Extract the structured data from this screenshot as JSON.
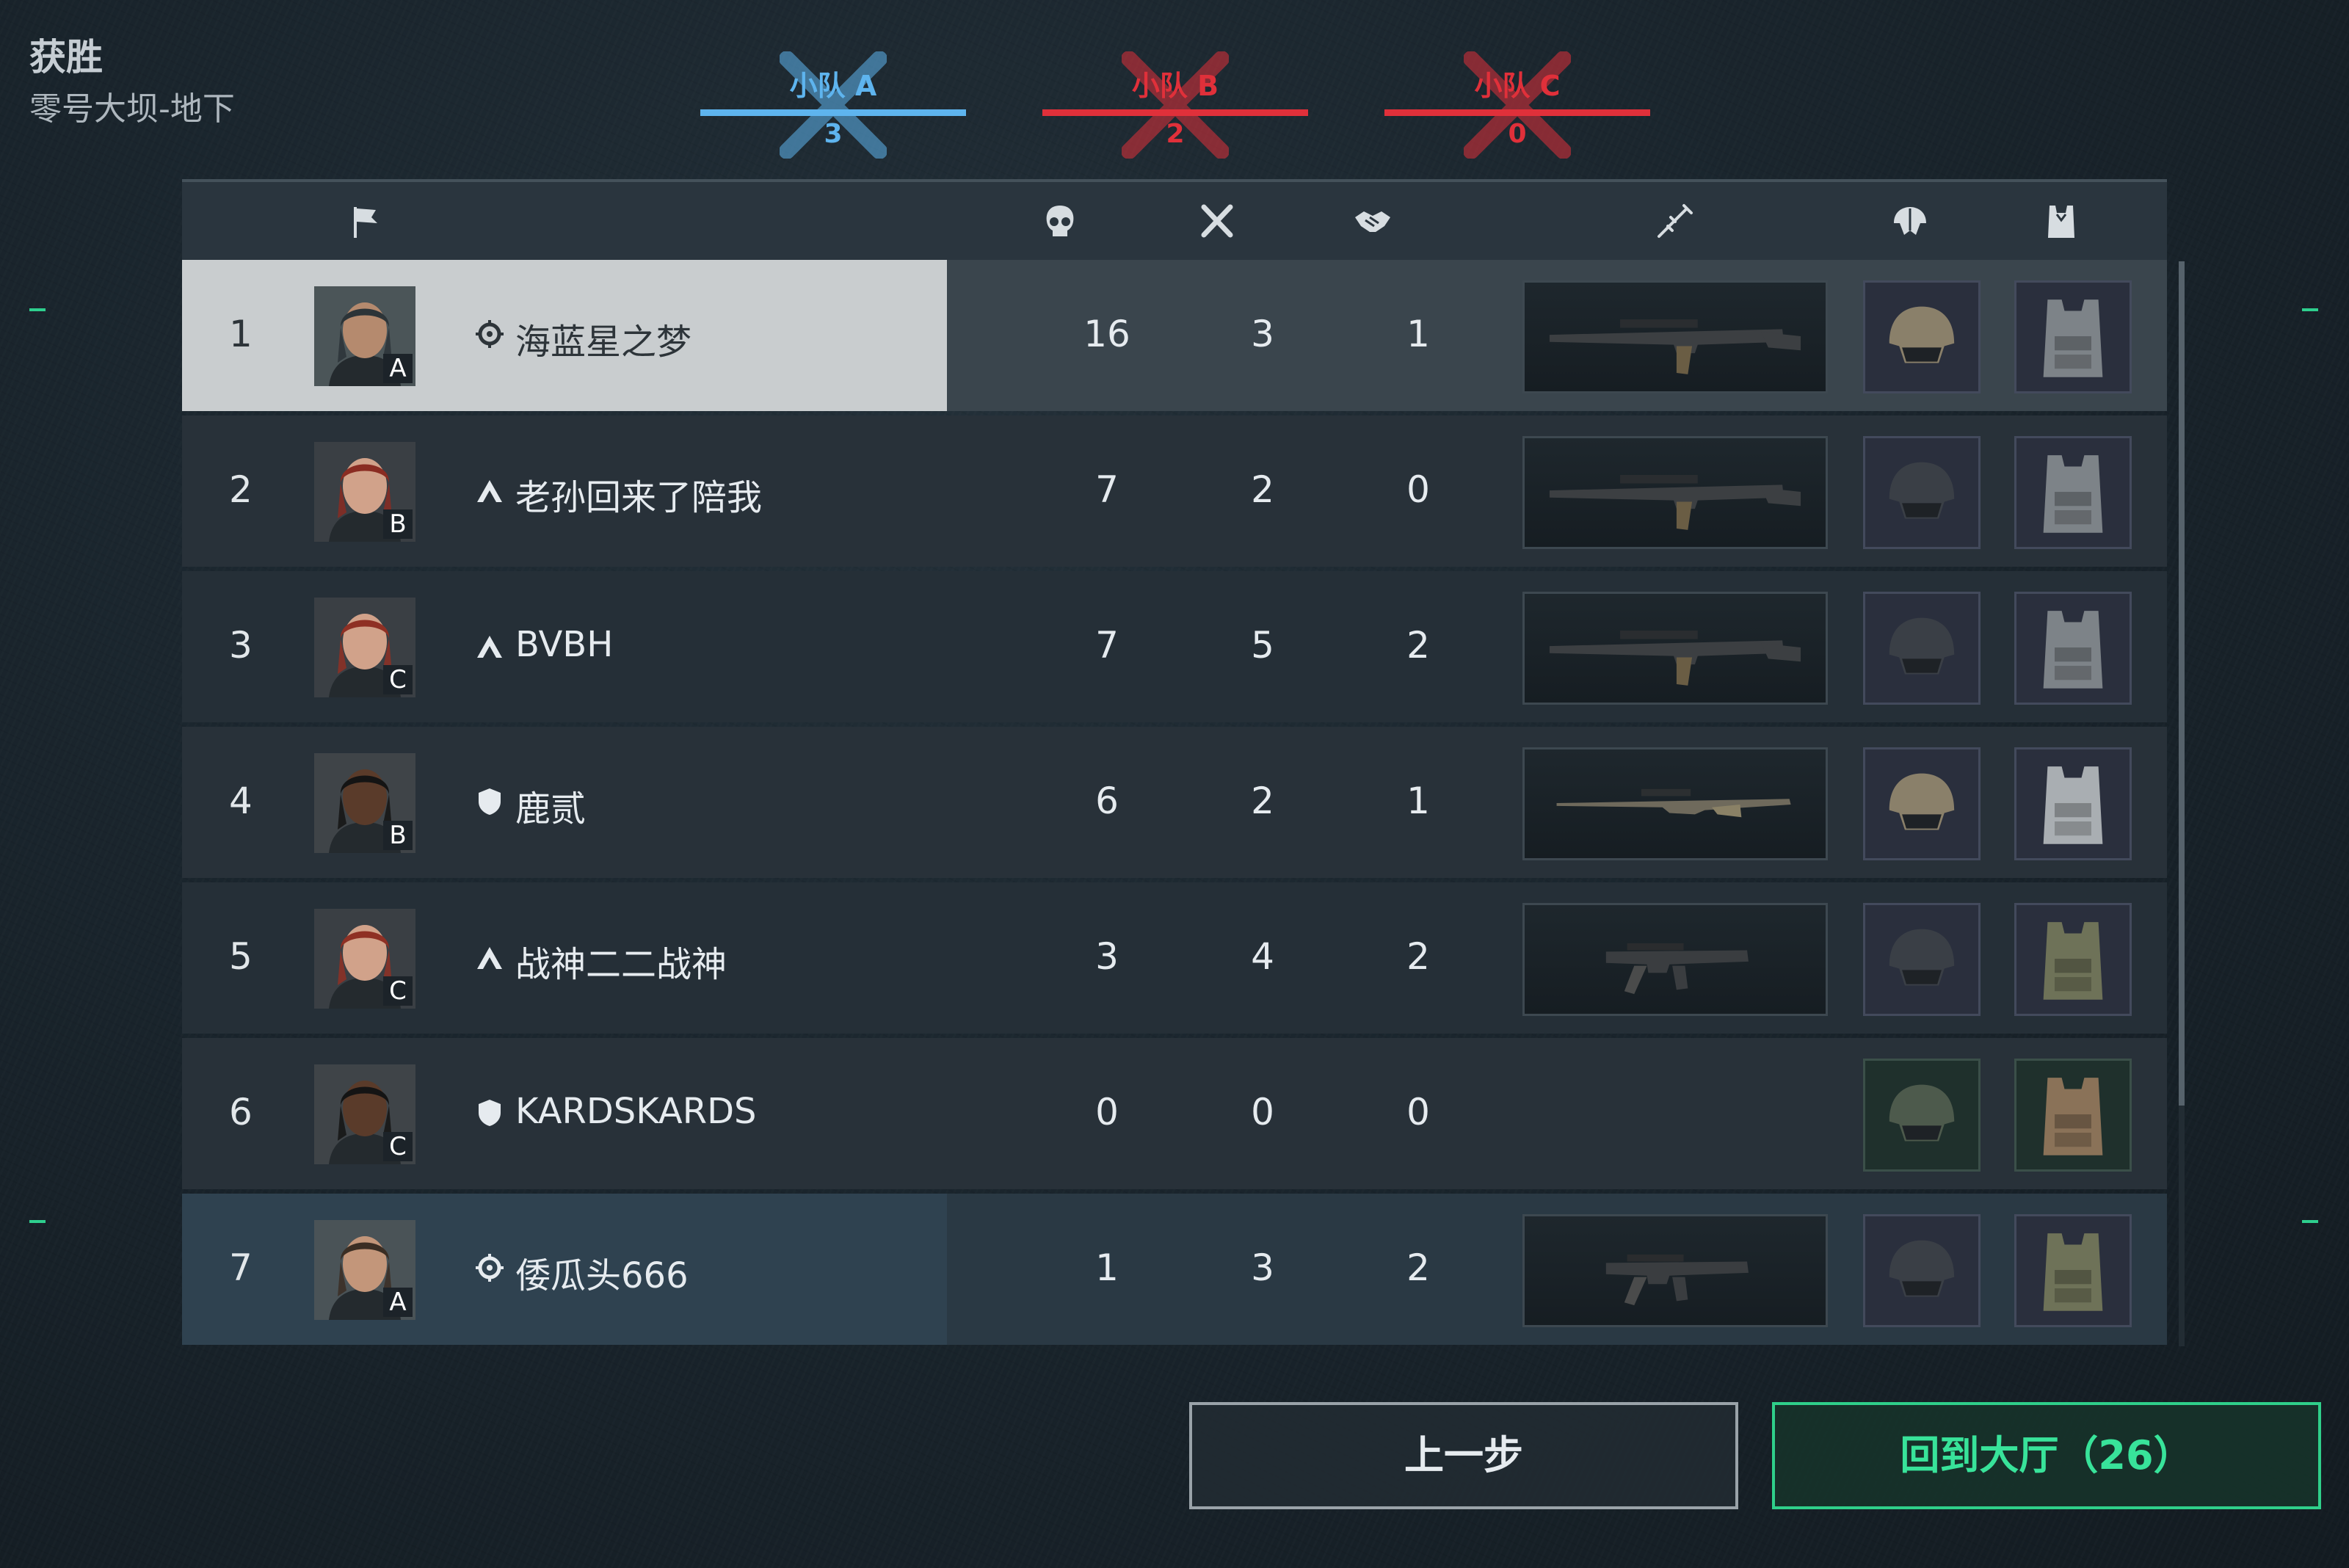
{
  "header": {
    "result": "获胜",
    "map": "零号大坝-地下"
  },
  "teams": [
    {
      "name": "小队 A",
      "score": "3",
      "color": "#5eb4ee"
    },
    {
      "name": "小队 B",
      "score": "2",
      "color": "#e0303a"
    },
    {
      "name": "小队 C",
      "score": "0",
      "color": "#e0303a"
    }
  ],
  "columns": {
    "flag": "flag-icon",
    "kills": "skull-icon",
    "deaths": "crossed-swords-icon",
    "assists": "handshake-icon",
    "weapon": "rifle-icon",
    "helmet": "helmet-icon",
    "armor": "vest-icon"
  },
  "players": [
    {
      "rank": "1",
      "squad": "A",
      "name": "海蓝星之梦",
      "rank_icon": "crosshair-badge-icon",
      "kills": "16",
      "deaths": "3",
      "assists": "1",
      "weapon": "assault-rifle",
      "helmet": "tan-helmet",
      "vest": "grey-camo-vest",
      "highlight": "self"
    },
    {
      "rank": "2",
      "squad": "B",
      "name": "老孙回来了陪我",
      "rank_icon": "chevron-badge-icon",
      "kills": "7",
      "deaths": "2",
      "assists": "0",
      "weapon": "assault-rifle",
      "helmet": "black-helmet",
      "vest": "grey-camo-vest"
    },
    {
      "rank": "3",
      "squad": "C",
      "name": "BVBH",
      "rank_icon": "chevron-badge-icon",
      "kills": "7",
      "deaths": "5",
      "assists": "2",
      "weapon": "assault-rifle",
      "helmet": "black-helmet",
      "vest": "grey-camo-vest"
    },
    {
      "rank": "4",
      "squad": "B",
      "name": "鹿贰",
      "rank_icon": "shield-badge-icon",
      "kills": "6",
      "deaths": "2",
      "assists": "1",
      "weapon": "sniper-rifle",
      "helmet": "tan-helmet",
      "vest": "light-vest"
    },
    {
      "rank": "5",
      "squad": "C",
      "name": "战神二二战神",
      "rank_icon": "chevron-badge-icon",
      "kills": "3",
      "deaths": "4",
      "assists": "2",
      "weapon": "smg",
      "helmet": "black-helmet",
      "vest": "green-camo-vest"
    },
    {
      "rank": "6",
      "squad": "C",
      "name": "KARDSKARDS",
      "rank_icon": "shield-badge-icon",
      "kills": "0",
      "deaths": "0",
      "assists": "0",
      "weapon": "",
      "helmet": "green-helmet",
      "vest": "tan-vest"
    },
    {
      "rank": "7",
      "squad": "A",
      "name": "倭瓜头666",
      "rank_icon": "crosshair-badge-icon",
      "kills": "1",
      "deaths": "3",
      "assists": "2",
      "weapon": "smg",
      "helmet": "black-helmet",
      "vest": "green-camo-vest",
      "highlight": "teammate"
    }
  ],
  "buttons": {
    "prev": "上一步",
    "lobby": "回到大厅（26）"
  }
}
